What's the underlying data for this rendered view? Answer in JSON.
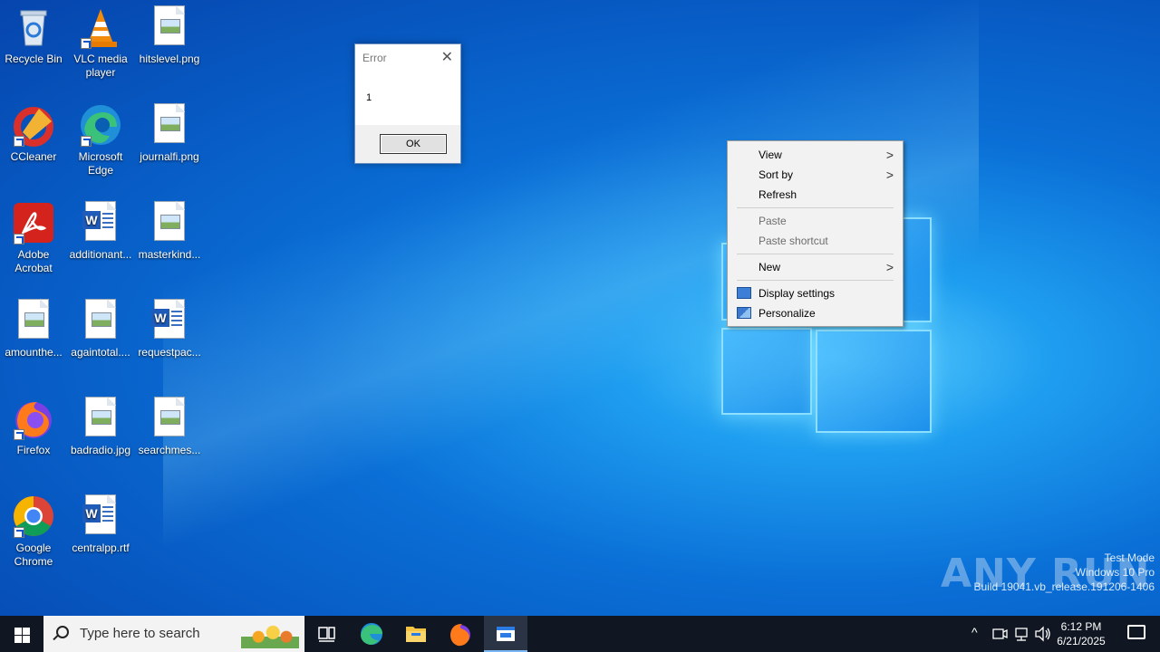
{
  "desktop": {
    "icons": [
      {
        "label": "Recycle Bin"
      },
      {
        "label": "VLC media player"
      },
      {
        "label": "hitslevel.png"
      },
      {
        "label": "CCleaner"
      },
      {
        "label": "Microsoft Edge"
      },
      {
        "label": "journalfi.png"
      },
      {
        "label": "Adobe Acrobat"
      },
      {
        "label": "additionant..."
      },
      {
        "label": "masterkind..."
      },
      {
        "label": "amounthe..."
      },
      {
        "label": "againtotal...."
      },
      {
        "label": "requestpac..."
      },
      {
        "label": "Firefox"
      },
      {
        "label": "badradio.jpg"
      },
      {
        "label": "searchmes..."
      },
      {
        "label": "Google Chrome"
      },
      {
        "label": "centralpp.rtf"
      }
    ]
  },
  "dialog": {
    "title": "Error",
    "close_glyph": "✕",
    "message": "1",
    "ok_label": "OK"
  },
  "context_menu": {
    "items": [
      {
        "label": "View",
        "submenu": true
      },
      {
        "label": "Sort by",
        "submenu": true
      },
      {
        "label": "Refresh"
      },
      {
        "label": "Paste",
        "disabled": true
      },
      {
        "label": "Paste shortcut",
        "disabled": true
      },
      {
        "label": "New",
        "submenu": true
      },
      {
        "label": "Display settings",
        "icon": "display-settings-icon"
      },
      {
        "label": "Personalize",
        "icon": "personalize-icon"
      }
    ],
    "arrow_glyph": ">"
  },
  "watermark": {
    "brand": "ANY RUN",
    "mode": "Test Mode",
    "edition": "Windows 10 Pro",
    "build": "Build 19041.vb_release.191206-1406"
  },
  "taskbar": {
    "search_placeholder": "Type here to search",
    "time": "6:12 PM",
    "date": "6/21/2025",
    "tray_chevron": "^"
  },
  "colors": {
    "taskbar_bg": "#101722",
    "accent": "#0078d7"
  }
}
